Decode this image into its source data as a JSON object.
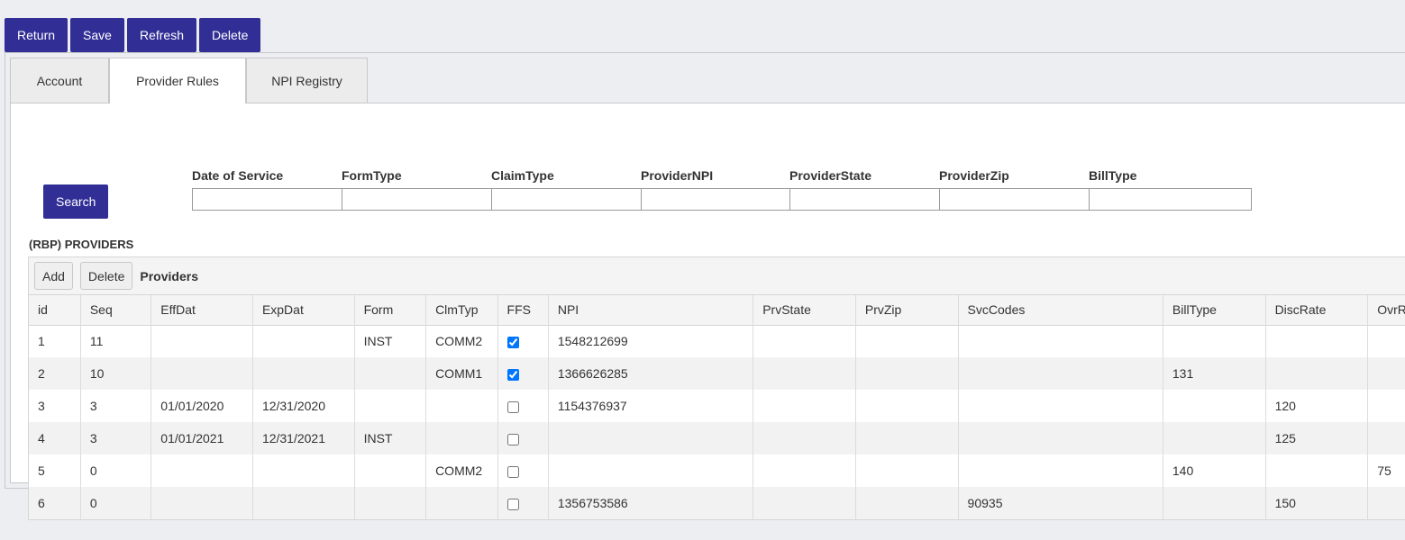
{
  "toolbar": {
    "return_label": "Return",
    "save_label": "Save",
    "refresh_label": "Refresh",
    "delete_label": "Delete"
  },
  "tabs": [
    {
      "label": "Account"
    },
    {
      "label": "Provider Rules"
    },
    {
      "label": "NPI Registry"
    }
  ],
  "search": {
    "button_label": "Search",
    "filters": [
      {
        "label": "Date of Service",
        "value": ""
      },
      {
        "label": "FormType",
        "value": ""
      },
      {
        "label": "ClaimType",
        "value": ""
      },
      {
        "label": "ProviderNPI",
        "value": ""
      },
      {
        "label": "ProviderState",
        "value": ""
      },
      {
        "label": "ProviderZip",
        "value": ""
      },
      {
        "label": "BillType",
        "value": ""
      }
    ]
  },
  "providers": {
    "section_title": "(RBP) PROVIDERS",
    "add_label": "Add",
    "delete_label": "Delete",
    "caption": "Providers",
    "columns": [
      "id",
      "Seq",
      "EffDat",
      "ExpDat",
      "Form",
      "ClmTyp",
      "FFS",
      "NPI",
      "PrvState",
      "PrvZip",
      "SvcCodes",
      "BillType",
      "DiscRate",
      "OvrRate"
    ],
    "rows": [
      {
        "id": "1",
        "seq": "11",
        "effdat": "",
        "expdat": "",
        "form": "INST",
        "clmtyp": "COMM2",
        "ffs": true,
        "npi": "1548212699",
        "prvstate": "",
        "prvzip": "",
        "svccodes": "",
        "billtype": "",
        "discrate": "",
        "ovrrate": ""
      },
      {
        "id": "2",
        "seq": "10",
        "effdat": "",
        "expdat": "",
        "form": "",
        "clmtyp": "COMM1",
        "ffs": true,
        "npi": "1366626285",
        "prvstate": "",
        "prvzip": "",
        "svccodes": "",
        "billtype": "131",
        "discrate": "",
        "ovrrate": ""
      },
      {
        "id": "3",
        "seq": "3",
        "effdat": "01/01/2020",
        "expdat": "12/31/2020",
        "form": "",
        "clmtyp": "",
        "ffs": false,
        "npi": "1154376937",
        "prvstate": "",
        "prvzip": "",
        "svccodes": "",
        "billtype": "",
        "discrate": "120",
        "ovrrate": ""
      },
      {
        "id": "4",
        "seq": "3",
        "effdat": "01/01/2021",
        "expdat": "12/31/2021",
        "form": "INST",
        "clmtyp": "",
        "ffs": false,
        "npi": "",
        "prvstate": "",
        "prvzip": "",
        "svccodes": "",
        "billtype": "",
        "discrate": "125",
        "ovrrate": ""
      },
      {
        "id": "5",
        "seq": "0",
        "effdat": "",
        "expdat": "",
        "form": "",
        "clmtyp": "COMM2",
        "ffs": false,
        "npi": "",
        "prvstate": "",
        "prvzip": "",
        "svccodes": "",
        "billtype": "140",
        "discrate": "",
        "ovrrate": "75"
      },
      {
        "id": "6",
        "seq": "0",
        "effdat": "",
        "expdat": "",
        "form": "",
        "clmtyp": "",
        "ffs": false,
        "npi": "1356753586",
        "prvstate": "",
        "prvzip": "",
        "svccodes": "90935",
        "billtype": "",
        "discrate": "150",
        "ovrrate": ""
      }
    ]
  },
  "colors": {
    "primary_button": "#312e96",
    "page_background": "#eceef2"
  }
}
